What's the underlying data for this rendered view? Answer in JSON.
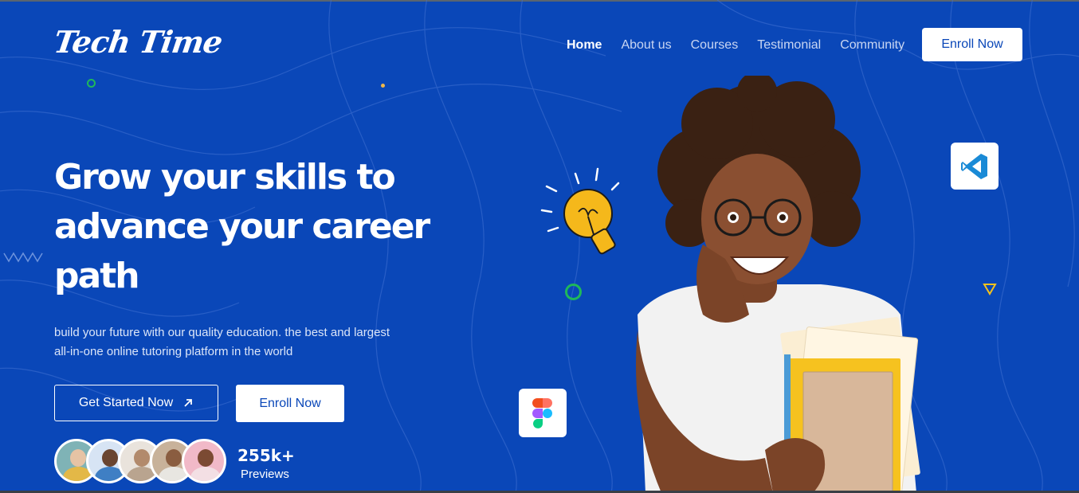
{
  "brand": {
    "logo_text": "Tech Time"
  },
  "nav": {
    "items": [
      "Home",
      "About us",
      "Courses",
      "Testimonial",
      "Community"
    ],
    "active": "Home",
    "cta_label": "Enroll Now"
  },
  "hero": {
    "headline_line1": "Grow your skills to",
    "headline_line2": "advance your career",
    "headline_line3": "path",
    "sub_line1": "build your future with our quality education. the best and largest",
    "sub_line2": "all-in-one online tutoring platform in the world",
    "primary_cta": "Get Started Now",
    "primary_cta_icon": "arrow-up-right-icon",
    "secondary_cta": "Enroll Now"
  },
  "stats": {
    "count": "255k+",
    "label": "Previews"
  },
  "icons": {
    "vscode": "vscode-icon",
    "figma": "figma-icon",
    "lightbulb": "lightbulb-icon"
  },
  "colors": {
    "background": "#0a47b8",
    "white": "#ffffff",
    "accent_green": "#1fb85a",
    "accent_yellow": "#f5c21b",
    "vscode_blue": "#1a8ad6"
  }
}
